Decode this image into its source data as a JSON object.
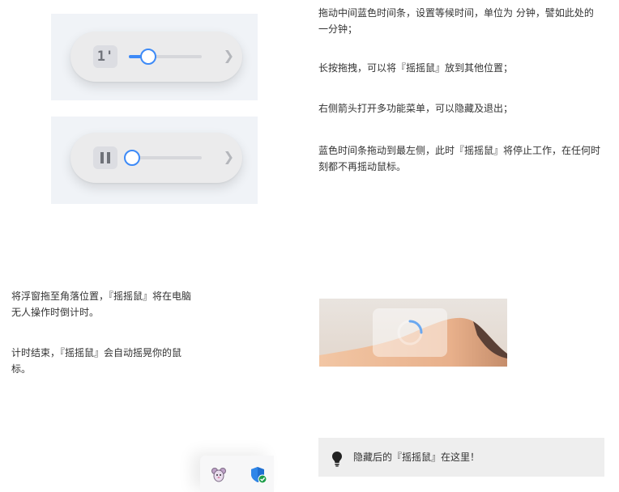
{
  "widget_top": {
    "timer_label": "1'",
    "progress_fraction": 0.2
  },
  "widget_bottom": {
    "left_icon": "pause-icon",
    "progress_fraction": 0.0
  },
  "right_descriptions": [
    "拖动中间蓝色时间条，设置等候时间，单位为 分钟，譬如此处的 一分钟；",
    "长按拖拽，可以将『摇摇鼠』放到其他位置；",
    "右侧箭头打开多功能菜单，可以隐藏及退出；",
    "蓝色时间条拖动到最左侧，此时『摇摇鼠』将停止工作，在任何时刻都不再摇动鼠标。"
  ],
  "left_descriptions": [
    "将浮窗拖至角落位置，『摇摇鼠』将在电脑无人操作时倒计时。",
    "计时结束，『摇摇鼠』会自动摇晃你的鼠标。"
  ],
  "tip": {
    "icon": "lightbulb-icon",
    "text": "隐藏后的『摇摇鼠』在这里！"
  },
  "tray_icons": [
    "mouse-app-icon",
    "security-shield-icon"
  ],
  "colors": {
    "accent": "#3d8af7",
    "panel_bg": "#f0f3f7",
    "widget_bg": "#ebebec",
    "tip_bg": "#eeeeee"
  }
}
